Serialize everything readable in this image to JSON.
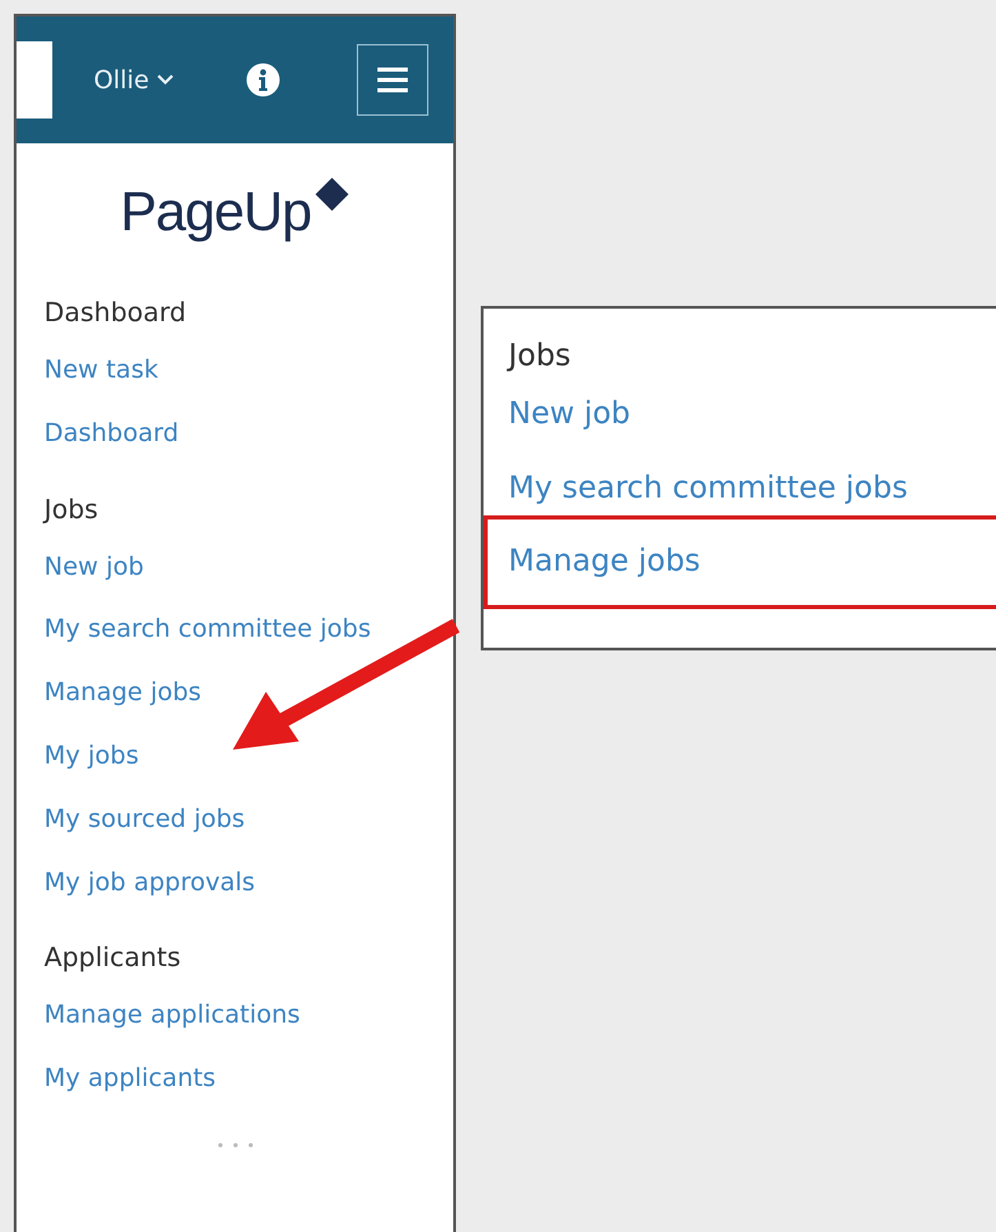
{
  "header": {
    "user": "Ollie"
  },
  "logo": {
    "text": "PageUp"
  },
  "sidebar": {
    "sections": [
      {
        "heading": "Dashboard",
        "items": [
          {
            "label": "New task"
          },
          {
            "label": "Dashboard"
          }
        ]
      },
      {
        "heading": "Jobs",
        "items": [
          {
            "label": "New job"
          },
          {
            "label": "My search committee jobs"
          },
          {
            "label": "Manage jobs"
          },
          {
            "label": "My jobs"
          },
          {
            "label": "My sourced jobs"
          },
          {
            "label": "My job approvals"
          }
        ]
      },
      {
        "heading": "Applicants",
        "items": [
          {
            "label": "Manage applications"
          },
          {
            "label": "My applicants"
          }
        ]
      }
    ]
  },
  "callout": {
    "heading": "Jobs",
    "items": [
      {
        "label": "New job",
        "highlighted": false
      },
      {
        "label": "My search committee jobs",
        "highlighted": false
      },
      {
        "label": "Manage jobs",
        "highlighted": true
      }
    ]
  }
}
